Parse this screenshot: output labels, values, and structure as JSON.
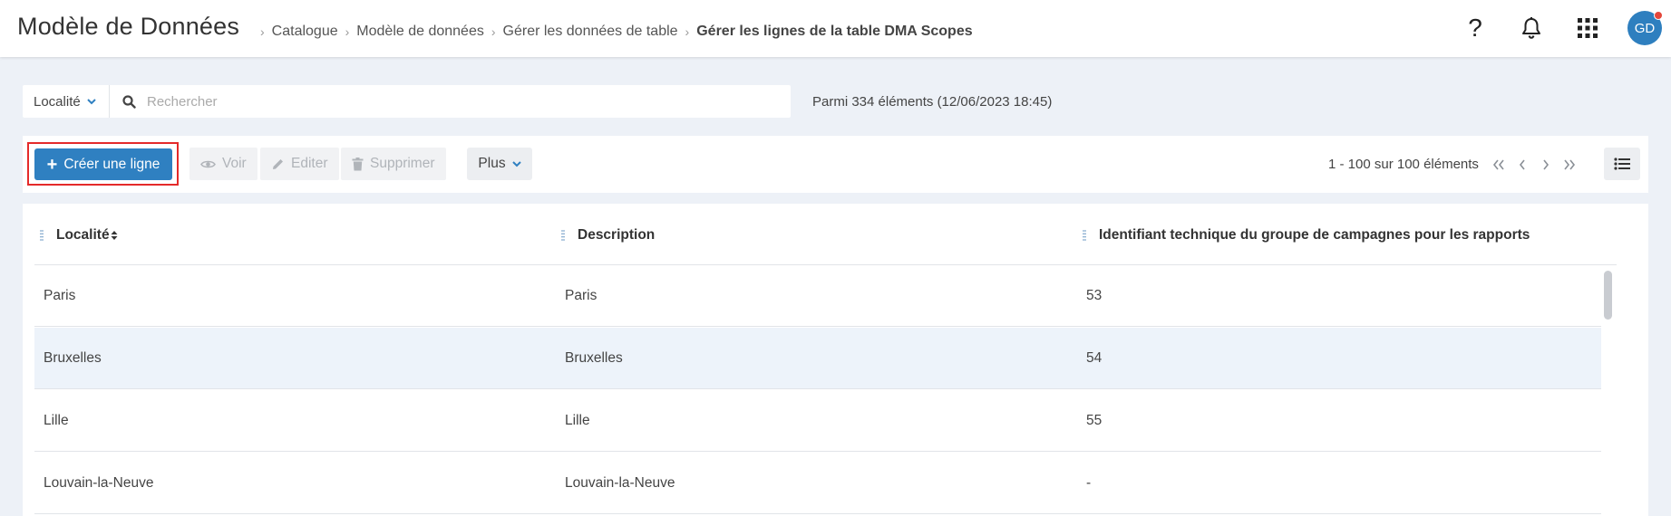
{
  "header": {
    "title": "Modèle de Données",
    "breadcrumb": [
      "Catalogue",
      "Modèle de données",
      "Gérer les données de table"
    ],
    "breadcrumb_current": "Gérer les lignes de la table DMA Scopes",
    "help_glyph": "?",
    "avatar_initials": "GD",
    "icons": [
      "question-icon",
      "bell-icon",
      "apps-grid-icon"
    ]
  },
  "search": {
    "filter_label": "Localité",
    "placeholder": "Rechercher",
    "value": "",
    "count_info": "Parmi 334 éléments (12/06/2023 18:45)"
  },
  "toolbar": {
    "create_label": "Créer une ligne",
    "view_label": "Voir",
    "edit_label": "Editer",
    "delete_label": "Supprimer",
    "more_label": "Plus",
    "pagination_info": "1 - 100 sur 100 éléments"
  },
  "table": {
    "columns": [
      "Localité",
      "Description",
      "Identifiant technique du groupe de campagnes pour les rapports"
    ],
    "rows": [
      [
        "Paris",
        "Paris",
        "53"
      ],
      [
        "Bruxelles",
        "Bruxelles",
        "54"
      ],
      [
        "Lille",
        "Lille",
        "55"
      ],
      [
        "Louvain-la-Neuve",
        "Louvain-la-Neuve",
        "-"
      ]
    ]
  },
  "colors": {
    "primary": "#2f80c1",
    "highlight_border": "#e42a2a",
    "notification_dot": "#e4473b",
    "row_alt": "#edf3fa",
    "page_bg": "#edf1f7"
  }
}
